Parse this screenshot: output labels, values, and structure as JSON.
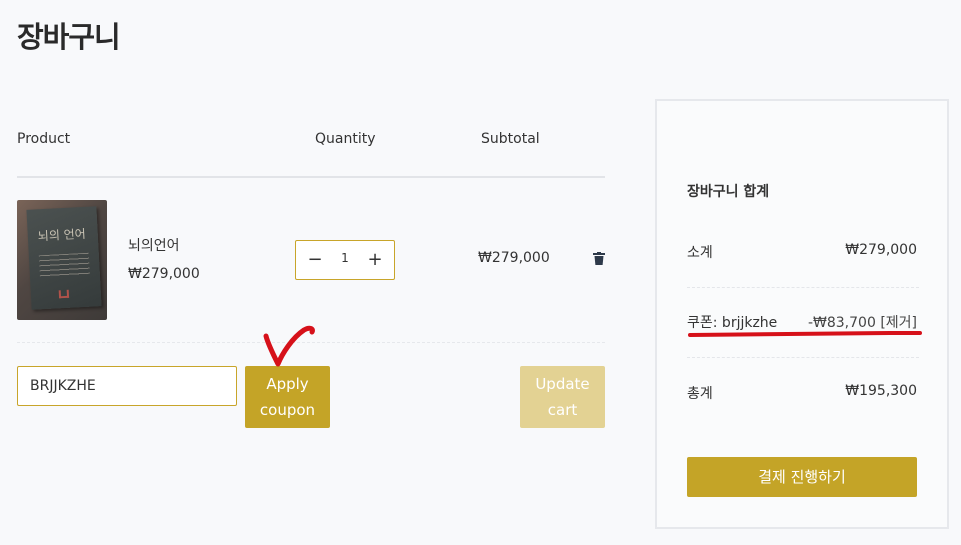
{
  "page": {
    "title": "장바구니"
  },
  "cart": {
    "headers": {
      "product": "Product",
      "quantity": "Quantity",
      "subtotal": "Subtotal"
    },
    "item": {
      "image_text": "뇌의 언어",
      "name": "뇌의언어",
      "price": "₩279,000",
      "quantity": "1",
      "subtotal": "₩279,000"
    },
    "coupon_value": "BRJJKZHE",
    "apply_label_1": "Apply",
    "apply_label_2": "coupon",
    "update_label_1": "Update",
    "update_label_2": "cart"
  },
  "totals": {
    "title": "장바구니 합계",
    "subtotal_label": "소계",
    "subtotal_value": "₩279,000",
    "coupon_label": "쿠폰: brjjkzhe",
    "coupon_value": "-₩83,700",
    "coupon_remove": "[제거]",
    "total_label": "총계",
    "total_value": "₩195,300",
    "checkout_label": "결제 진행하기"
  },
  "annotations": {
    "ink_color": "#d6111a"
  },
  "icons": {
    "minus": "minus-icon",
    "plus": "plus-icon",
    "trash": "trash-icon"
  }
}
